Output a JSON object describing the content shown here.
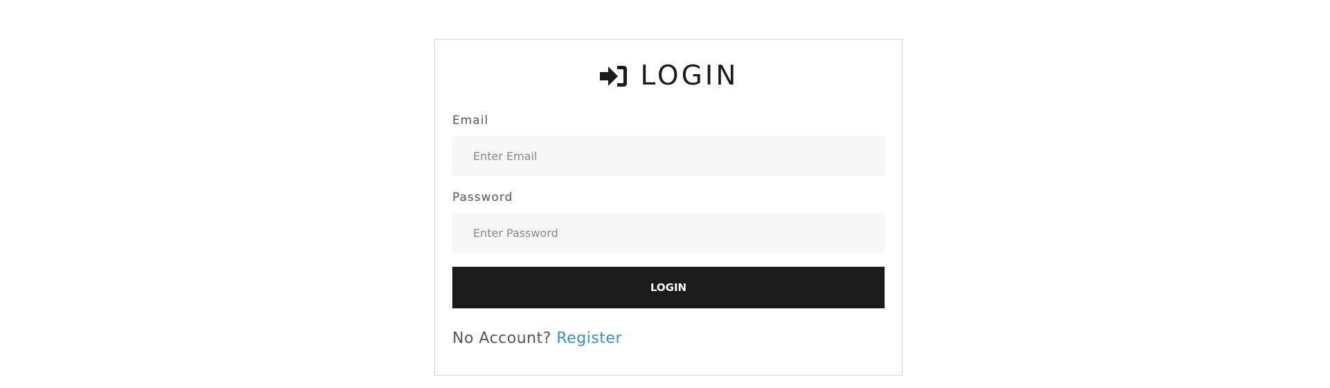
{
  "login": {
    "title": "LOGIN",
    "title_icon": "sign-in-icon",
    "email": {
      "label": "Email",
      "placeholder": "Enter Email",
      "value": ""
    },
    "password": {
      "label": "Password",
      "placeholder": "Enter Password",
      "value": ""
    },
    "submit_label": "LOGIN",
    "no_account_text": "No Account?",
    "register_link": "Register"
  },
  "colors": {
    "button_background": "#1b1b1b",
    "input_background": "#f6f6f7",
    "link": "#3391c4",
    "card_border": "#d6d6d6"
  }
}
